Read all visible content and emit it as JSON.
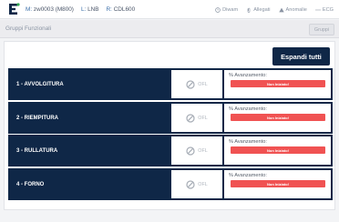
{
  "header": {
    "m_label": "M:",
    "m_value": "zw0003 (M800)",
    "l_label": "L:",
    "l_value": "LNB",
    "r_label": "R:",
    "r_value": "CDL600",
    "tools": [
      {
        "label": "Diwam",
        "icon": "clock-icon"
      },
      {
        "label": "Allegati",
        "icon": "paperclip-icon"
      },
      {
        "label": "Anomalie",
        "icon": "warning-icon"
      },
      {
        "label": "ECG",
        "icon": "dots-icon"
      }
    ]
  },
  "subheader": {
    "title": "Gruppi Funzionali",
    "button_label": "Gruppi"
  },
  "expand_button": "Espandi tutti",
  "groups": [
    {
      "name": "1 - AVVOLGITURA",
      "status": "OFL",
      "progress_label": "% Avanzamento:",
      "progress_text": "Non Iniziato!"
    },
    {
      "name": "2 - RIEMPITURA",
      "status": "OFL",
      "progress_label": "% Avanzamento:",
      "progress_text": "Non Iniziato!"
    },
    {
      "name": "3 - RULLATURA",
      "status": "OFL",
      "progress_label": "% Avanzamento:",
      "progress_text": "Non Iniziato!"
    },
    {
      "name": "4 - FORNO",
      "status": "OFL",
      "progress_label": "% Avanzamento:",
      "progress_text": "Non Iniziato!"
    }
  ],
  "colors": {
    "navy": "#0f2747",
    "danger": "#f05252",
    "accent": "#3a6ea8"
  }
}
